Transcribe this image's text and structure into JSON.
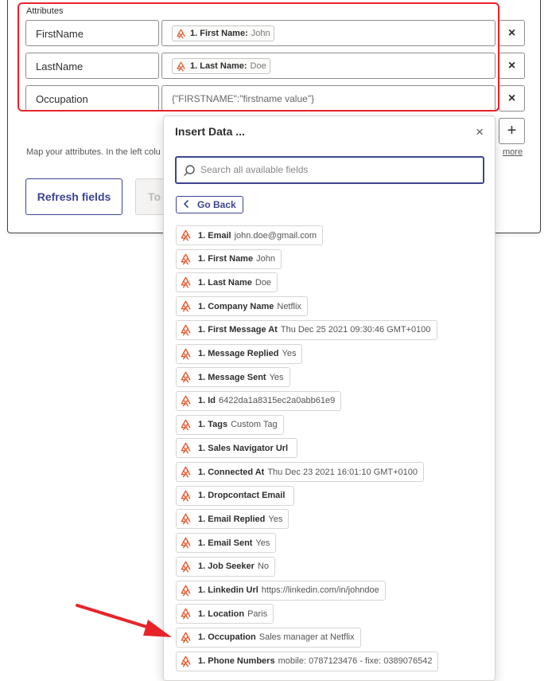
{
  "attributes": {
    "section_label": "Attributes",
    "rows": [
      {
        "key": "FirstName",
        "pill_key": "1. First Name:",
        "pill_value": "John"
      },
      {
        "key": "LastName",
        "pill_key": "1. Last Name:",
        "pill_value": "Doe"
      },
      {
        "key": "Occupation",
        "value_text": "{\"FIRSTNAME\":\"firstname value\"}"
      }
    ],
    "remove_label": "×",
    "add_label": "+",
    "help_text": "Map your attributes. In the left colu",
    "more_link": "more",
    "refresh_label": "Refresh fields",
    "to_label": "To"
  },
  "popup": {
    "title": "Insert Data ...",
    "close_label": "×",
    "search_placeholder": "Search all available fields",
    "go_back_label": "Go Back",
    "items": [
      {
        "k": "1. Email",
        "v": "john.doe@gmail.com"
      },
      {
        "k": "1. First Name",
        "v": "John"
      },
      {
        "k": "1. Last Name",
        "v": "Doe"
      },
      {
        "k": "1. Company Name",
        "v": "Netflix"
      },
      {
        "k": "1. First Message At",
        "v": "Thu Dec 25 2021 09:30:46 GMT+0100"
      },
      {
        "k": "1. Message Replied",
        "v": "Yes"
      },
      {
        "k": "1. Message Sent",
        "v": "Yes"
      },
      {
        "k": "1. Id",
        "v": "6422da1a8315ec2a0abb61e9"
      },
      {
        "k": "1. Tags",
        "v": "Custom Tag"
      },
      {
        "k": "1. Sales Navigator Url",
        "v": ""
      },
      {
        "k": "1. Connected At",
        "v": "Thu Dec 23 2021 16:01:10 GMT+0100"
      },
      {
        "k": "1. Dropcontact Email",
        "v": ""
      },
      {
        "k": "1. Email Replied",
        "v": "Yes"
      },
      {
        "k": "1. Email Sent",
        "v": "Yes"
      },
      {
        "k": "1. Job Seeker",
        "v": "No"
      },
      {
        "k": "1. Linkedin Url",
        "v": "https://linkedin.com/in/johndoe"
      },
      {
        "k": "1. Location",
        "v": "Paris"
      },
      {
        "k": "1. Occupation",
        "v": "Sales manager at Netflix"
      },
      {
        "k": "1. Phone Numbers",
        "v": "mobile: 0787123476 - fixe: 0389076542"
      }
    ]
  },
  "colors": {
    "accent": "#3d4592",
    "zap_orange": "#e4633a",
    "highlight_red": "#e8242a"
  },
  "icons": {
    "zap": "zapier-step-icon",
    "search": "search-icon",
    "close": "close-icon",
    "back": "chevron-left-icon",
    "annotation": "red-arrow-annotation"
  }
}
